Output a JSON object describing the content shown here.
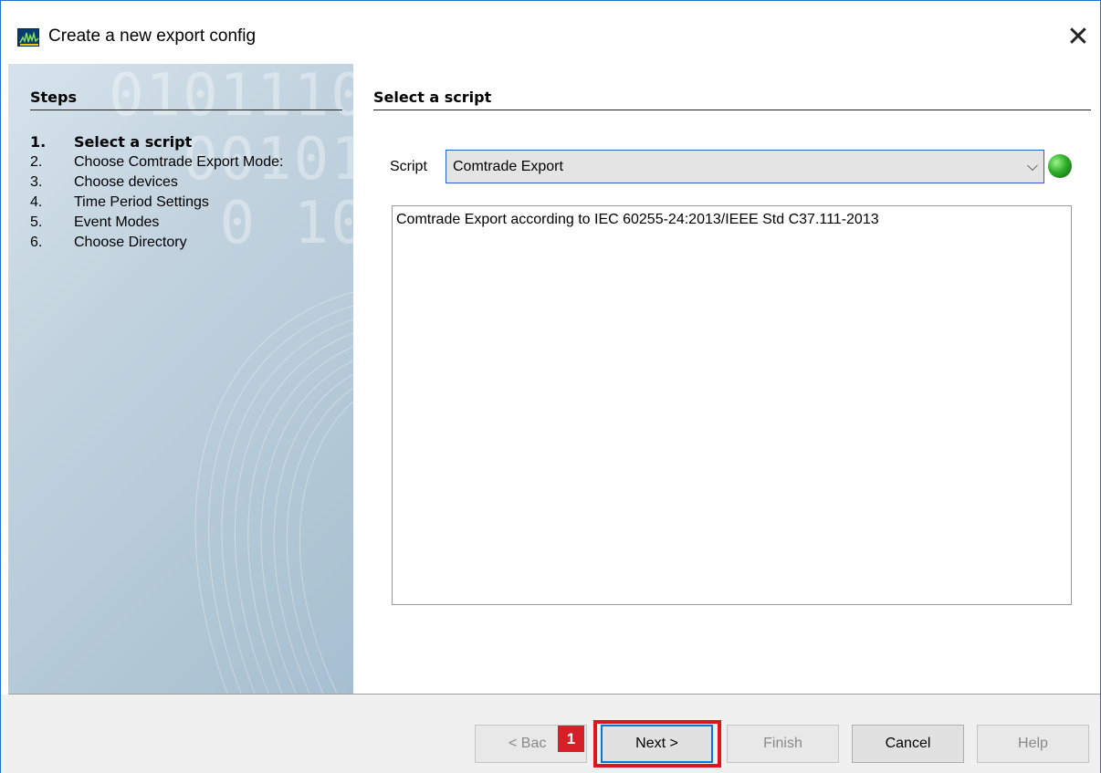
{
  "window": {
    "title": "Create a new export config",
    "close_symbol": "✕",
    "icon": "app-waveform-icon"
  },
  "steps": {
    "title": "Steps",
    "items": [
      {
        "num": "1.",
        "label": "Select a script",
        "active": true
      },
      {
        "num": "2.",
        "label": "Choose Comtrade Export Mode:"
      },
      {
        "num": "3.",
        "label": "Choose devices"
      },
      {
        "num": "4.",
        "label": "Time Period Settings"
      },
      {
        "num": "5.",
        "label": "Event Modes"
      },
      {
        "num": "6.",
        "label": "Choose Directory"
      }
    ]
  },
  "main": {
    "title": "Select a script",
    "script_label": "Script",
    "script_value": "Comtrade Export",
    "status_color": "#2fae2a",
    "description": "Comtrade Export according to IEC 60255-24:2013/IEEE Std C37.111-2013"
  },
  "footer": {
    "back_label": "< Bac",
    "next_label": "Next >",
    "finish_label": "Finish",
    "cancel_label": "Cancel",
    "help_label": "Help",
    "annotation_badge": "1",
    "highlight_color": "#e0141c"
  }
}
